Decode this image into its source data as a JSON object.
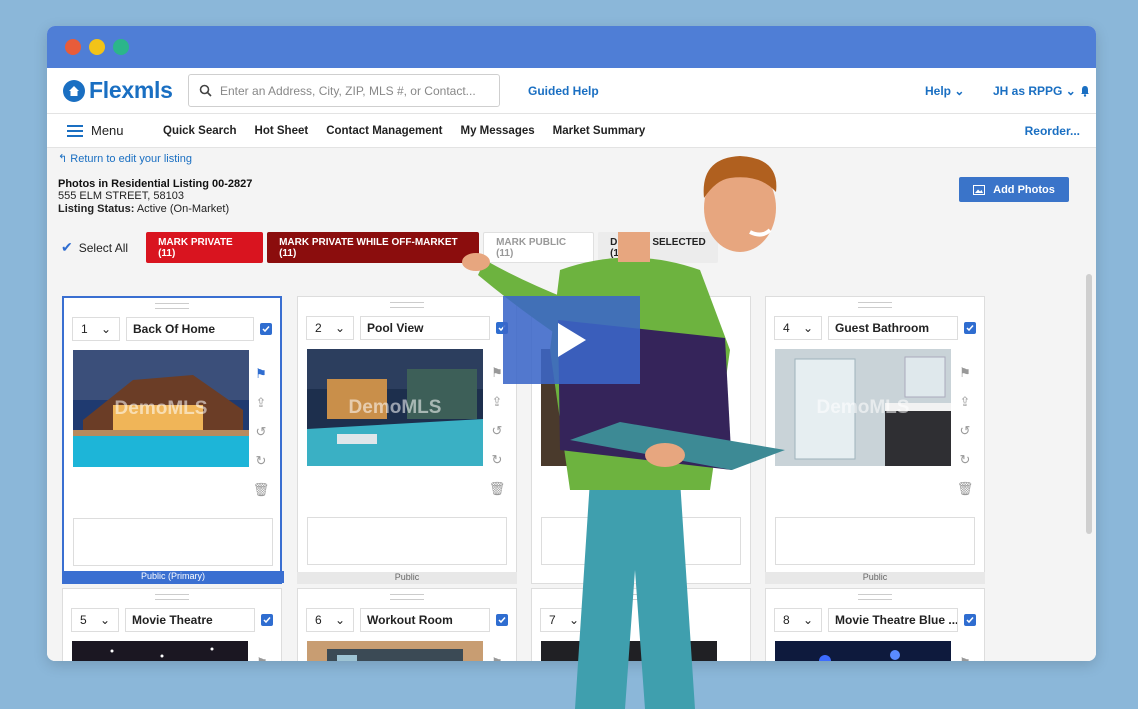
{
  "colors": {
    "brand": "#1a6fc2",
    "titlebar": "#4f7ed6",
    "red": "#d9141f",
    "dark_red": "#8b0d0d",
    "accent": "#3a74c9"
  },
  "window": {
    "traffic": [
      "#e85c3a",
      "#f2c318",
      "#2bb68a"
    ]
  },
  "header": {
    "logo": "Flexmls",
    "search_placeholder": "Enter an Address, City, ZIP, MLS #, or Contact...",
    "guided_help": "Guided Help",
    "help": "Help",
    "user": "JH as RPPG"
  },
  "nav": {
    "menu": "Menu",
    "links": [
      "Quick Search",
      "Hot Sheet",
      "Contact Management",
      "My Messages",
      "Market Summary"
    ],
    "reorder": "Reorder..."
  },
  "listing": {
    "return_link": "Return to edit your listing",
    "title": "Photos in Residential Listing 00-2827",
    "address": "555 ELM STREET, 58103",
    "status_label": "Listing Status:",
    "status_value": "Active (On-Market)",
    "add_photos": "Add Photos"
  },
  "actions": {
    "select_all": "Select All",
    "mark_private": "MARK PRIVATE (11)",
    "mark_private_off": "MARK PRIVATE WHILE OFF-MARKET (11)",
    "mark_public": "MARK PUBLIC (11)",
    "delete_selected": "DELETE SELECTED (11)"
  },
  "photos": [
    {
      "num": "1",
      "name": "Back Of Home",
      "status": "Public (Primary)",
      "watermark": "DemoMLS"
    },
    {
      "num": "2",
      "name": "Pool View",
      "status": "Public",
      "watermark": "DemoMLS"
    },
    {
      "num": "4",
      "name": "Guest Bathroom",
      "status": "Public",
      "watermark": "DemoMLS"
    },
    {
      "num": "5",
      "name": "Movie Theatre"
    },
    {
      "num": "6",
      "name": "Workout Room"
    },
    {
      "num": "7",
      "name": ""
    },
    {
      "num": "8",
      "name": "Movie Theatre Blue ..."
    }
  ]
}
